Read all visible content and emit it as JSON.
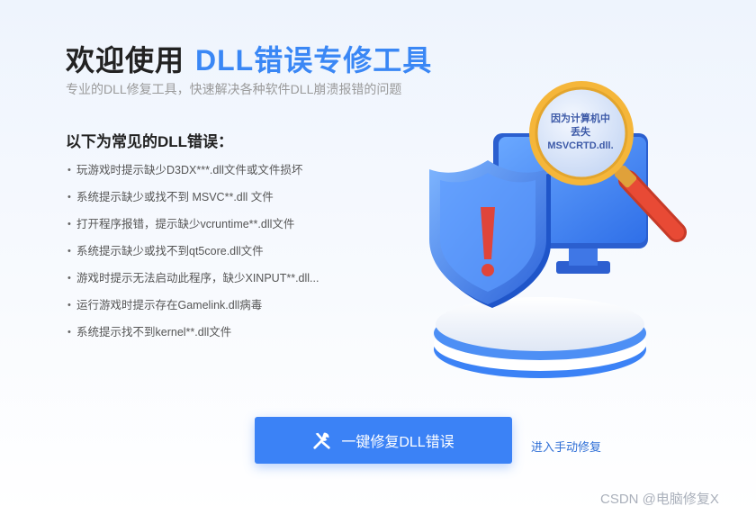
{
  "header": {
    "title_prefix": "欢迎使用",
    "title_accent": "DLL错误专修工具",
    "subtitle": "专业的DLL修复工具，快速解决各种软件DLL崩溃报错的问题"
  },
  "errors": {
    "heading": "以下为常见的DLL错误：",
    "bullet": "•",
    "items": [
      "玩游戏时提示缺少D3DX***.dll文件或文件损坏",
      "系统提示缺少或找不到 MSVC**.dll 文件",
      "打开程序报错，提示缺少vcruntime**.dll文件",
      "系统提示缺少或找不到qt5core.dll文件",
      "游戏时提示无法启动此程序，缺少XINPUT**.dll...",
      "运行游戏时提示存在Gamelink.dll病毒",
      "系统提示找不到kernel**.dll文件"
    ]
  },
  "illustration": {
    "magnifier_lines": [
      "因为计算机中",
      "丢失",
      "MSVCRTD.dll."
    ],
    "icons": [
      "shield-icon",
      "monitor-icon",
      "magnifier-icon",
      "exclamation-icon"
    ]
  },
  "actions": {
    "fix_button_label": "一键修复DLL错误",
    "fix_button_icon": "tools-icon",
    "manual_link": "进入手动修复"
  },
  "watermark": "CSDN @电脑修复X",
  "colors": {
    "accent": "#3a87f5",
    "button": "#3b82f6",
    "link": "#2f6fd6",
    "shield_red": "#e0453a",
    "magnifier_gold": "#f5b63a",
    "handle_red": "#e84a35"
  }
}
